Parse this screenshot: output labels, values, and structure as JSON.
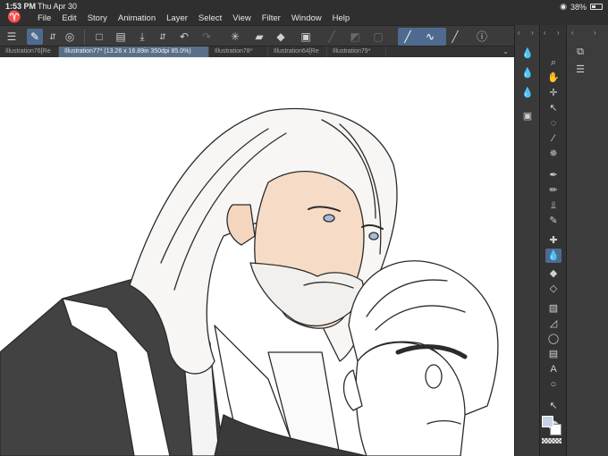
{
  "status": {
    "time": "1:53 PM",
    "date": "Thu Apr 30",
    "battery": "38%"
  },
  "menu": [
    "File",
    "Edit",
    "Story",
    "Animation",
    "Layer",
    "Select",
    "View",
    "Filter",
    "Window",
    "Help"
  ],
  "tabs": [
    {
      "label": "Illustration76[Re",
      "active": false
    },
    {
      "label": "Illustration77* (13.26 x 16.89in 350dpi 85.0%)",
      "active": true
    },
    {
      "label": "Illustration78*",
      "active": false
    },
    {
      "label": "Illustration64[Re",
      "active": false
    },
    {
      "label": "Illustration79*",
      "active": false
    }
  ],
  "colors": {
    "accent": "#4e6b8f",
    "main_color": "#c7d3e4",
    "sub_color": "#ffffff"
  },
  "icons": {
    "toolbar": [
      "menu-icon",
      "edit-mode-icon",
      "stepper-icon",
      "view-icon",
      "new-file-icon",
      "open-file-icon",
      "save-icon",
      "export-icon",
      "undo-icon",
      "redo-icon",
      "loading-icon",
      "fill-icon",
      "transform-icon",
      "clear-selection-icon",
      "invert-selection-icon",
      "deselect-icon",
      "pen-stroke-icon",
      "smooth-stroke-icon",
      "pen-pressure-icon",
      "help-icon"
    ],
    "tools": [
      "zoom-icon",
      "hand-icon",
      "move-icon",
      "object-select-icon",
      "lasso-icon",
      "eyedropper-icon",
      "magic-wand-icon",
      "pen-icon",
      "pencil-icon",
      "airbrush-icon",
      "marker-icon",
      "sparkle-icon",
      "blend-icon",
      "fill-bucket-icon",
      "eraser-icon",
      "gradient-icon",
      "figure-icon",
      "ellipse-icon",
      "frame-icon",
      "text-icon",
      "balloon-icon",
      "correction-icon"
    ]
  }
}
